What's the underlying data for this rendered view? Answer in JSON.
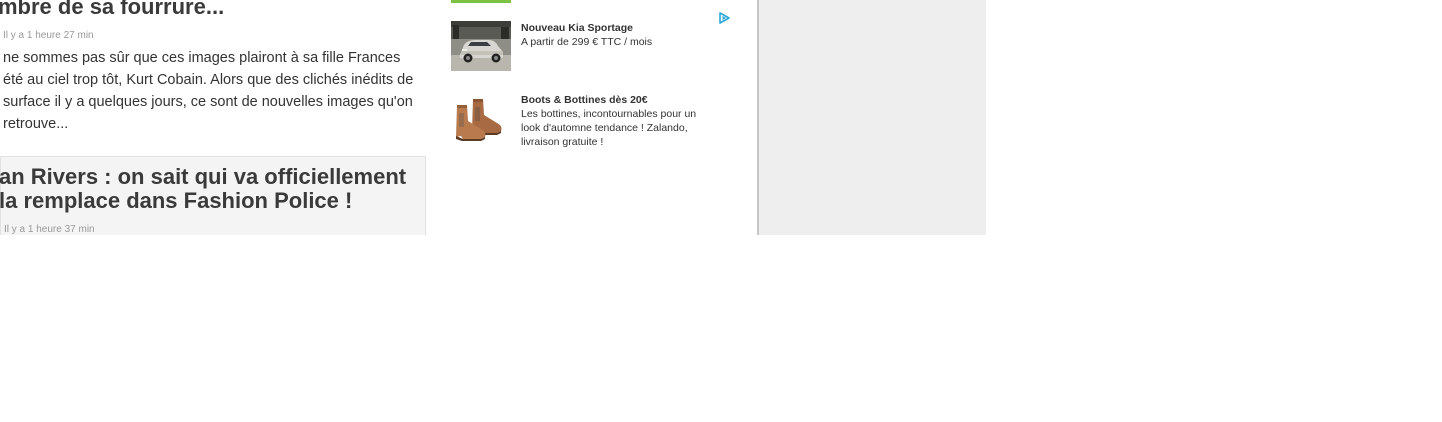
{
  "articles": [
    {
      "title": "mbre de sa fourrure...",
      "time": "Il y a 1 heure 27 min",
      "excerpt": "ne sommes pas sûr que ces images plairont à sa fille Frances été au ciel trop tôt, Kurt Cobain. Alors que des clichés inédits de surface il y a quelques jours, ce sont de nouvelles images qu'on retrouve..."
    },
    {
      "title": "an Rivers : on sait qui va officiellement la remplace dans Fashion Police !",
      "time": "Il y a 1 heure 37 min"
    }
  ],
  "ads": [
    {
      "title": "Nouveau Kia Sportage",
      "desc": "A partir de 299 € TTC / mois",
      "thumb": "car-thumbnail"
    },
    {
      "title": "Boots & Bottines dès 20€",
      "desc": "Les bottines, incontournables pour un look d'automne tendance ! Zalando, livraison gratuite !",
      "thumb": "boots-thumbnail"
    }
  ],
  "colors": {
    "accent_green": "#7cc243",
    "adchoices_blue": "#2aa7d9",
    "sidebar_bg": "#eeeeee"
  },
  "icons": [
    "adchoices-icon"
  ]
}
